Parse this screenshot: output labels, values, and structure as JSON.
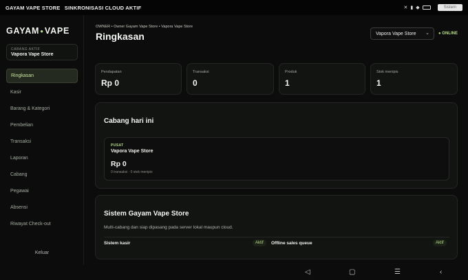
{
  "status_bar": {
    "left_texts": [
      "GAYAM VAPE STORE",
      "SINKRONISASI CLOUD AKTIF"
    ],
    "right_badge": "Sistem"
  },
  "sidebar": {
    "brand_left": "GAYAM",
    "brand_right": "VAPE",
    "branch_caption": "CABANG AKTIF",
    "branch_name": "Vapora Vape Store",
    "items": [
      {
        "label": "Ringkasan",
        "active": true
      },
      {
        "label": "Kasir"
      },
      {
        "label": "Barang & Kategori"
      },
      {
        "label": "Pembelian"
      },
      {
        "label": "Transaksi"
      },
      {
        "label": "Laporan"
      },
      {
        "label": "Cabang"
      },
      {
        "label": "Pegawai"
      },
      {
        "label": "Absensi"
      },
      {
        "label": "Riwayat Check-out"
      }
    ],
    "logout_label": "Keluar"
  },
  "header": {
    "breadcrumb": "OWNER • Owner Gayam Vape Store • Vapora Vape Store",
    "title": "Ringkasan",
    "branch_select_value": "Vapora Vape Store",
    "online_label": "● ONLINE"
  },
  "stats": [
    {
      "label": "Pendapatan",
      "value": "Rp 0"
    },
    {
      "label": "Transaksi",
      "value": "0"
    },
    {
      "label": "Produk",
      "value": "1"
    },
    {
      "label": "Stok menipis",
      "value": "1"
    }
  ],
  "today": {
    "title": "Cabang hari ini",
    "tag": "PUSAT",
    "branch_name": "Vapora Vape Store",
    "amount": "Rp 0",
    "meta": "0 transaksi · 0 stok menipis"
  },
  "system": {
    "title": "Sistem Gayam Vape Store",
    "description": "Multi-cabang dan siap dipasang pada server lokal maupun cloud.",
    "rows": [
      {
        "label": "Sistem kasir",
        "status": "Aktif"
      },
      {
        "label": "Offline sales queue",
        "status": "Aktif"
      }
    ]
  },
  "colors": {
    "accent": "#b9dd8a",
    "background": "#0b0c0b",
    "card": "#121412"
  }
}
